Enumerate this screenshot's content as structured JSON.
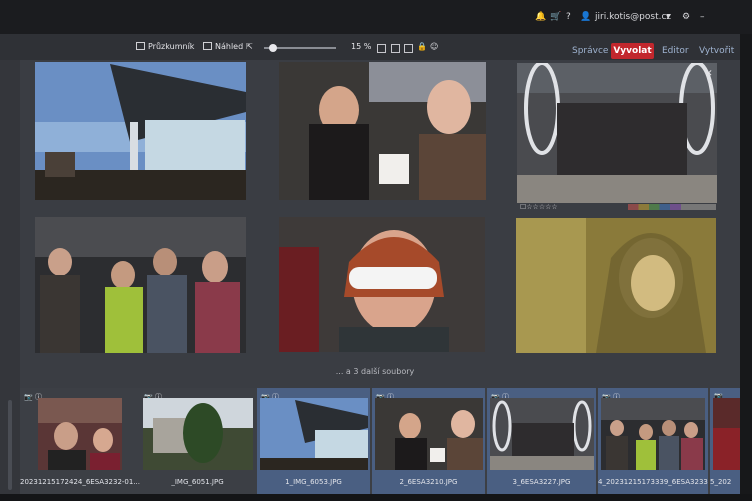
{
  "system_bar": {
    "account": "jiri.kotis@post.cz",
    "icons": [
      "notification-icon",
      "cart-icon",
      "help-icon",
      "user-icon",
      "caret-down-icon",
      "settings-icon"
    ]
  },
  "toolbar": {
    "explorer_label": "Průzkumník",
    "preview_label": "Náhled",
    "zoom_value": "15 %"
  },
  "modes": {
    "manager": "Správce",
    "develop": "Vyvolat",
    "editor": "Editor",
    "create": "Vytvořit"
  },
  "preview": {
    "more_files": "... a 3 další soubory"
  },
  "filmstrip": {
    "items": [
      {
        "label": "20231215172424_6ESA3232-01...",
        "selected": false
      },
      {
        "label": "_IMG_6051.JPG",
        "selected": false
      },
      {
        "label": "1_IMG_6053.JPG",
        "selected": true
      },
      {
        "label": "2_6ESA3210.JPG",
        "selected": true
      },
      {
        "label": "3_6ESA3227.JPG",
        "selected": true
      },
      {
        "label": "4_20231215173339_6ESA3233-0...",
        "selected": true
      },
      {
        "label": "5_202",
        "selected": true
      }
    ]
  },
  "colors": {
    "accent_red": "#c2272d",
    "selection_blue": "#4a5f82",
    "mode_blue": "#9fb3d0"
  }
}
